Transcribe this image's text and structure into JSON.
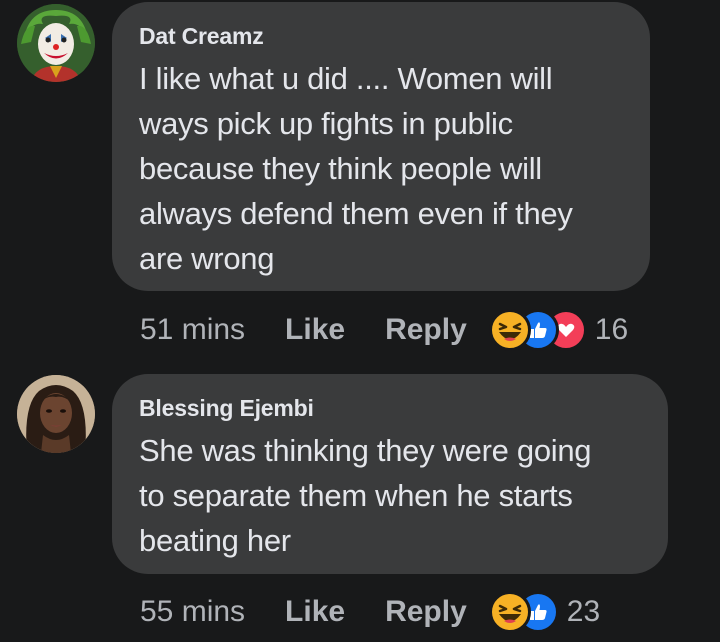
{
  "comments": [
    {
      "author": "Dat Creamz",
      "avatar_icon": "joker-avatar-icon",
      "lines": [
        "I like what u did .... Women will",
        "ways pick up fights in public",
        "because they think people will",
        "always defend them even if they",
        "are wrong"
      ],
      "time": "51 mins",
      "like_label": "Like",
      "reply_label": "Reply",
      "reactions": [
        "haha",
        "like",
        "love"
      ],
      "reaction_count": "16"
    },
    {
      "author": "Blessing Ejembi",
      "avatar_icon": "woman-avatar-icon",
      "lines": [
        "She was thinking they were going",
        "to separate them when he starts",
        "beating her"
      ],
      "time": "55 mins",
      "like_label": "Like",
      "reply_label": "Reply",
      "reactions": [
        "haha",
        "like"
      ],
      "reaction_count": "23"
    }
  ],
  "colors": {
    "background": "#18191a",
    "bubble": "#3a3b3c",
    "primary_text": "#e4e6eb",
    "secondary_text": "#b0b3b8",
    "like_blue": "#1877f2",
    "love_red": "#f33e58",
    "haha_yellow": "#f7b125"
  }
}
